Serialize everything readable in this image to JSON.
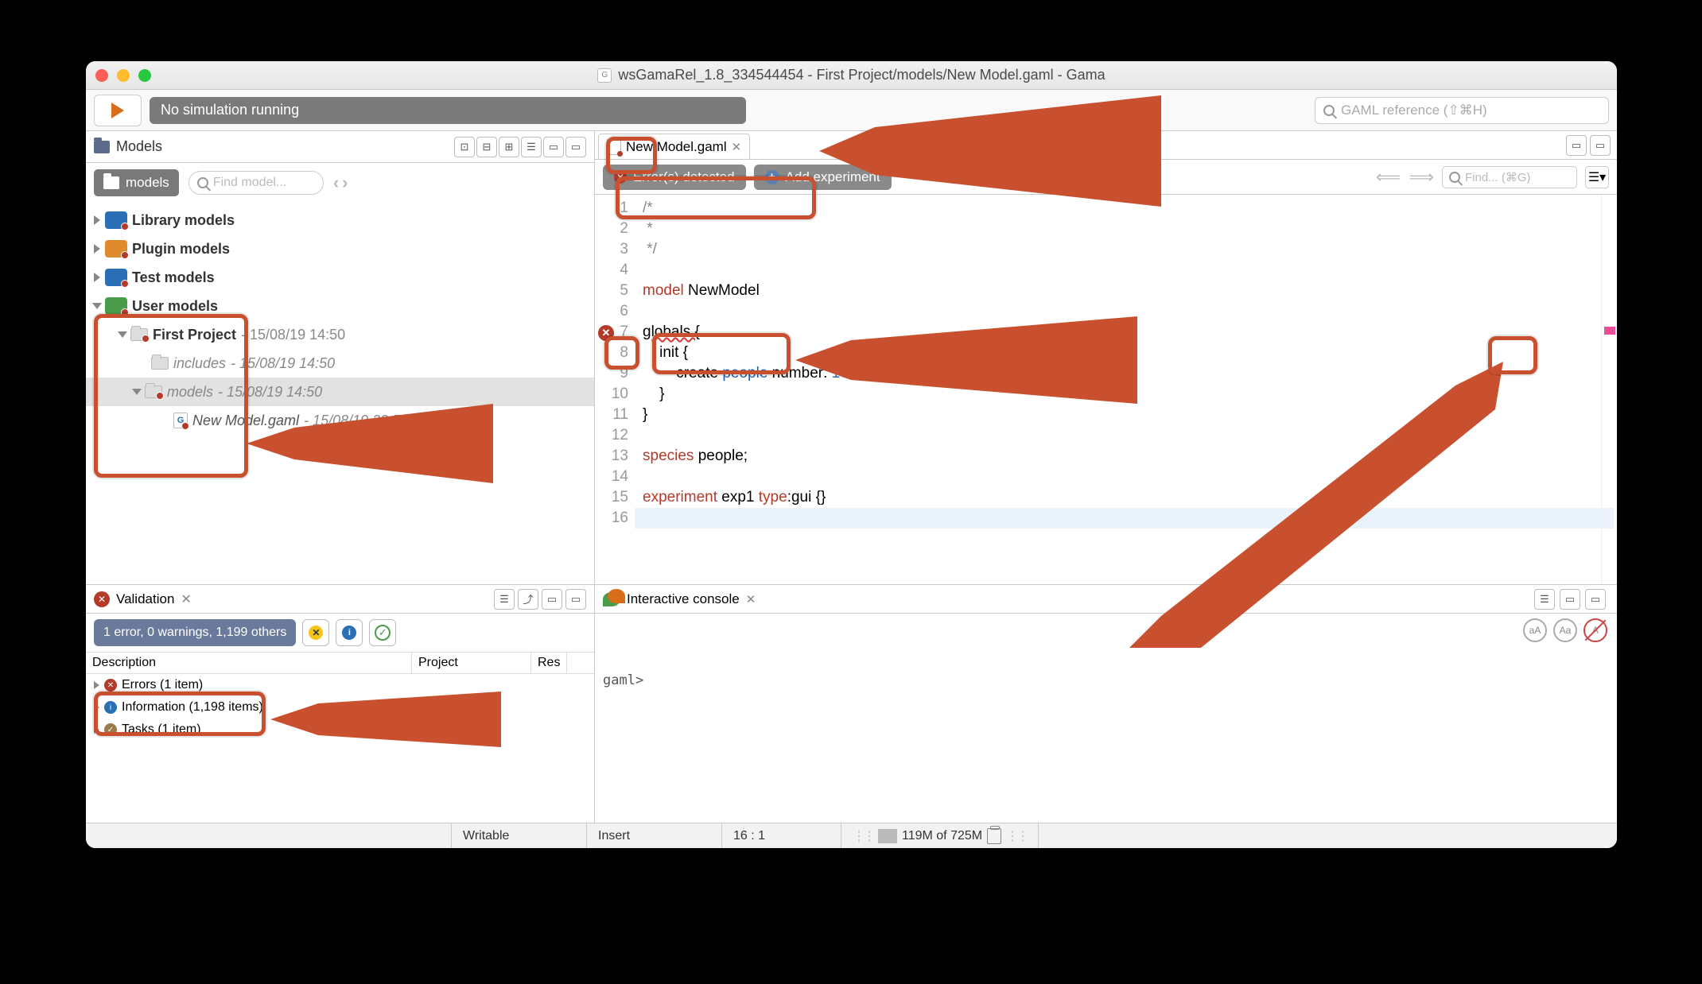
{
  "window": {
    "title": "wsGamaRel_1.8_334544454 - First Project/models/New Model.gaml - Gama"
  },
  "toolbar": {
    "sim_status": "No simulation running",
    "search_placeholder": "GAML reference (⇧⌘H)"
  },
  "models_panel": {
    "title": "Models",
    "breadcrumb": "models",
    "find_placeholder": "Find model...",
    "tree": {
      "library": "Library models",
      "plugin": "Plugin models",
      "test": "Test models",
      "user": "User models",
      "project": "First Project",
      "project_date": "- 15/08/19 14:50",
      "includes": "includes",
      "includes_date": "- 15/08/19 14:50",
      "models_folder": "models",
      "models_folder_date": "- 15/08/19 14:50",
      "new_model": "New Model.gaml",
      "new_model_date": "- 15/08/19 23:56"
    }
  },
  "editor": {
    "tab_name": "New Model.gaml",
    "errors_pill": "Error(s) detected",
    "add_exp": "Add experiment",
    "find_placeholder": "Find... (⌘G)",
    "line_numbers": [
      "1",
      "2",
      "3",
      "4",
      "5",
      "6",
      "7",
      "8",
      "9",
      "10",
      "11",
      "12",
      "13",
      "14",
      "15",
      "16"
    ],
    "code": {
      "l1": "/*",
      "l2": " *",
      "l3": " */",
      "l5_kw": "model",
      "l5_name": " NewModel",
      "l7_err": "globals {",
      "l8": "    init {",
      "l9a": "        create ",
      "l9b": "people",
      "l9c": " number: ",
      "l9d": "10",
      "l9e": ";",
      "l10": "    }",
      "l11": "}",
      "l13a": "species",
      "l13b": " people;",
      "l15a": "experiment",
      "l15b": " exp1 ",
      "l15c": "type",
      "l15d": ":gui {}"
    }
  },
  "validation": {
    "title": "Validation",
    "summary": "1 error, 0 warnings, 1,199 others",
    "col_desc": "Description",
    "col_proj": "Project",
    "col_res": "Res",
    "errors": "Errors (1 item)",
    "info": "Information (1,198 items)",
    "tasks": "Tasks (1 item)"
  },
  "console": {
    "title": "Interactive console",
    "prompt": "gaml>"
  },
  "status": {
    "writable": "Writable",
    "insert": "Insert",
    "cursor": "16 : 1",
    "heap": "119M of 725M"
  }
}
